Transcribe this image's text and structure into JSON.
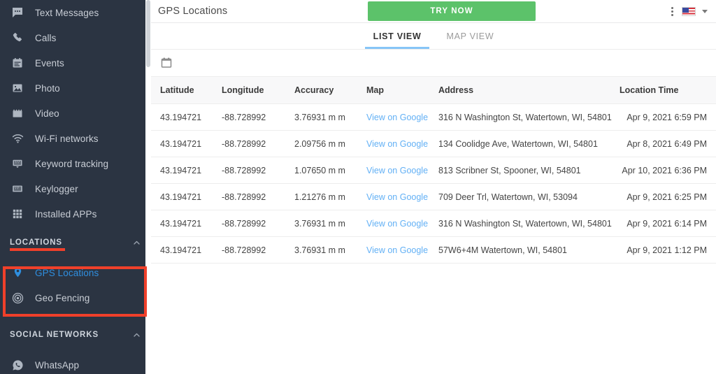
{
  "sidebar": {
    "items": [
      {
        "label": "Text Messages",
        "icon": "chat-icon"
      },
      {
        "label": "Calls",
        "icon": "phone-icon"
      },
      {
        "label": "Events",
        "icon": "calendar-events-icon"
      },
      {
        "label": "Photo",
        "icon": "image-icon"
      },
      {
        "label": "Video",
        "icon": "clapperboard-icon"
      },
      {
        "label": "Wi-Fi networks",
        "icon": "wifi-icon"
      },
      {
        "label": "Keyword tracking",
        "icon": "keyword-icon"
      },
      {
        "label": "Keylogger",
        "icon": "keyboard-icon"
      },
      {
        "label": "Installed APPs",
        "icon": "grid-apps-icon"
      }
    ],
    "locations_section": {
      "title": "LOCATIONS",
      "items": [
        {
          "label": "GPS Locations",
          "icon": "map-pin-icon",
          "active": true
        },
        {
          "label": "Geo Fencing",
          "icon": "target-icon",
          "active": false
        }
      ]
    },
    "social_section": {
      "title": "SOCIAL NETWORKS",
      "items": [
        {
          "label": "WhatsApp",
          "icon": "whatsapp-icon"
        }
      ]
    },
    "accent_highlight": "#f0402a",
    "background": "#2b3442",
    "active_color": "#2f8fe0"
  },
  "header": {
    "title": "GPS Locations",
    "cta_label": "TRY NOW",
    "cta_color": "#5cc26a",
    "kebab": "more-vertical-icon",
    "locale_flag": "us-flag-icon"
  },
  "tabs": [
    {
      "label": "LIST VIEW",
      "active": true
    },
    {
      "label": "MAP VIEW",
      "active": false
    }
  ],
  "toolbar": {
    "date_picker_icon": "calendar-icon"
  },
  "table": {
    "columns": [
      "Latitude",
      "Longitude",
      "Accuracy",
      "Map",
      "Address",
      "Location Time"
    ],
    "map_link_label": "View on Google",
    "link_color": "#62b0f5",
    "rows": [
      {
        "latitude": "43.194721",
        "longitude": "-88.728992",
        "accuracy": "3.76931 m m",
        "map": "View on Google",
        "address": "316 N Washington St, Watertown, WI, 54801",
        "time": "Apr 9, 2021 6:59 PM"
      },
      {
        "latitude": "43.194721",
        "longitude": "-88.728992",
        "accuracy": "2.09756 m m",
        "map": "View on Google",
        "address": "134 Coolidge Ave, Watertown, WI, 54801",
        "time": "Apr 8, 2021 6:49 PM"
      },
      {
        "latitude": "43.194721",
        "longitude": "-88.728992",
        "accuracy": "1.07650 m m",
        "map": "View on Google",
        "address": "813 Scribner St, Spooner, WI, 54801",
        "time": "Apr 10, 2021 6:36 PM"
      },
      {
        "latitude": "43.194721",
        "longitude": "-88.728992",
        "accuracy": "1.21276 m m",
        "map": "View on Google",
        "address": "709 Deer Trl, Watertown, WI, 53094",
        "time": "Apr 9, 2021 6:25 PM"
      },
      {
        "latitude": "43.194721",
        "longitude": "-88.728992",
        "accuracy": "3.76931 m m",
        "map": "View on Google",
        "address": "316 N Washington St, Watertown, WI, 54801",
        "time": "Apr 9, 2021 6:14 PM"
      },
      {
        "latitude": "43.194721",
        "longitude": "-88.728992",
        "accuracy": "3.76931 m m",
        "map": "View on Google",
        "address": "57W6+4M Watertown, WI, 54801",
        "time": "Apr 9, 2021 1:12 PM"
      }
    ]
  }
}
